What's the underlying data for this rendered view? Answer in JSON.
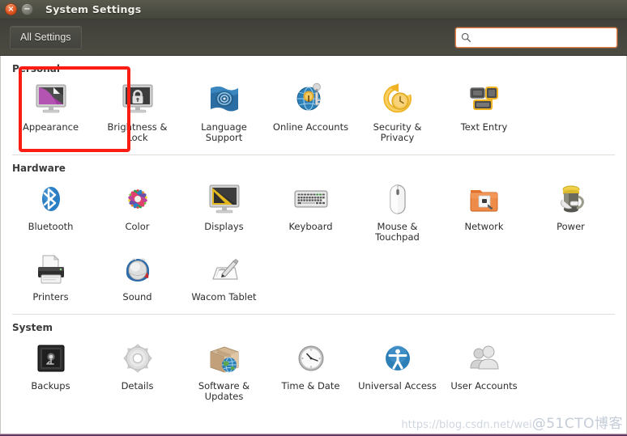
{
  "window": {
    "title": "System Settings",
    "close_label": "×",
    "minimize_label": "−"
  },
  "toolbar": {
    "all_settings_label": "All Settings",
    "search_value": "",
    "search_placeholder": ""
  },
  "highlight": {
    "target": "Brightness & Lock",
    "color": "#fb1c13"
  },
  "watermark": {
    "url_text": "https://blog.csdn.net/wei",
    "site_text": "@51CTO博客"
  },
  "sections": [
    {
      "title": "Personal",
      "items": [
        {
          "label": "Appearance",
          "icon": "appearance-icon"
        },
        {
          "label": "Brightness & Lock",
          "icon": "brightness-lock-icon"
        },
        {
          "label": "Language Support",
          "icon": "language-support-icon"
        },
        {
          "label": "Online Accounts",
          "icon": "online-accounts-icon"
        },
        {
          "label": "Security & Privacy",
          "icon": "security-privacy-icon"
        },
        {
          "label": "Text Entry",
          "icon": "text-entry-icon"
        }
      ]
    },
    {
      "title": "Hardware",
      "items": [
        {
          "label": "Bluetooth",
          "icon": "bluetooth-icon"
        },
        {
          "label": "Color",
          "icon": "color-icon"
        },
        {
          "label": "Displays",
          "icon": "displays-icon"
        },
        {
          "label": "Keyboard",
          "icon": "keyboard-icon"
        },
        {
          "label": "Mouse & Touchpad",
          "icon": "mouse-touchpad-icon"
        },
        {
          "label": "Network",
          "icon": "network-icon"
        },
        {
          "label": "Power",
          "icon": "power-icon"
        },
        {
          "label": "Printers",
          "icon": "printers-icon"
        },
        {
          "label": "Sound",
          "icon": "sound-icon"
        },
        {
          "label": "Wacom Tablet",
          "icon": "wacom-tablet-icon"
        }
      ]
    },
    {
      "title": "System",
      "items": [
        {
          "label": "Backups",
          "icon": "backups-icon"
        },
        {
          "label": "Details",
          "icon": "details-icon"
        },
        {
          "label": "Software & Updates",
          "icon": "software-updates-icon"
        },
        {
          "label": "Time & Date",
          "icon": "time-date-icon"
        },
        {
          "label": "Universal Access",
          "icon": "universal-access-icon"
        },
        {
          "label": "User Accounts",
          "icon": "user-accounts-icon"
        }
      ]
    }
  ]
}
